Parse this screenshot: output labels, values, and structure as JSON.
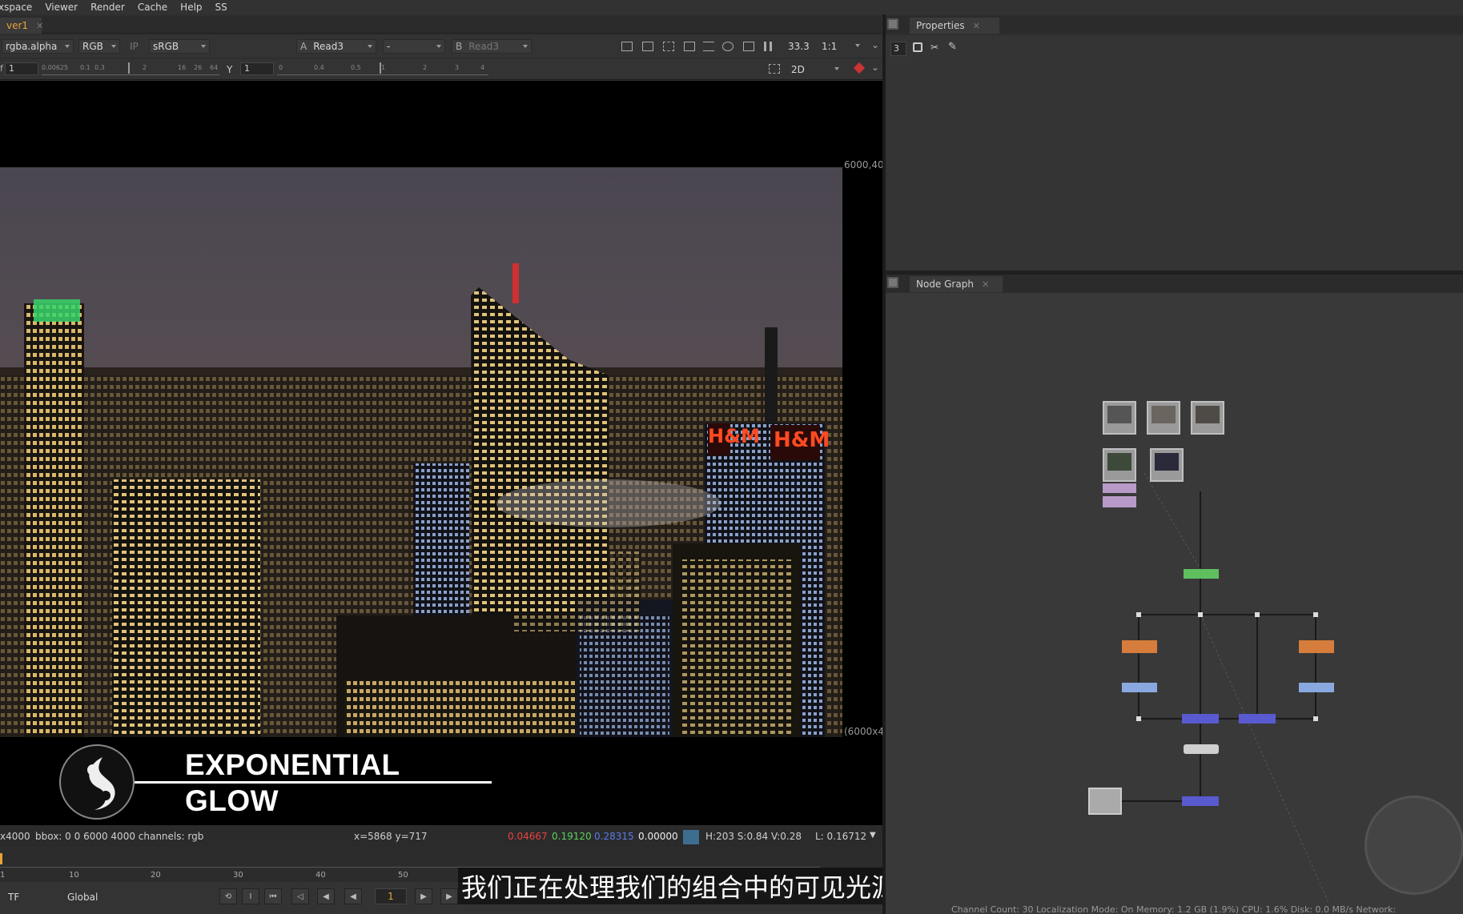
{
  "menu": [
    "xspace",
    "Viewer",
    "Render",
    "Cache",
    "Help",
    "SS"
  ],
  "viewer": {
    "tab_label": "ver1",
    "channels": "rgba.alpha",
    "colorspace_rgb": "RGB",
    "ip": "IP",
    "lut": "sRGB",
    "input_a_label": "A",
    "input_a": "Read3",
    "blend": "-",
    "input_b_label": "B",
    "input_b": "Read3",
    "zoom": "33.3",
    "proxy": "1:1",
    "gain_value": "1",
    "gamma_label": "Y",
    "gamma_value": "1",
    "view_mode": "2D",
    "gain_ticks": [
      "0.00625",
      "0.1",
      "0.3",
      "2",
      "16",
      "26",
      "64"
    ],
    "gamma_ticks": [
      "0",
      "0.4",
      "0.5",
      "1",
      "2",
      "3",
      "4"
    ],
    "format_top": "6000,40",
    "format_bottom": "(6000x4"
  },
  "logo": {
    "line1": "EXPONENTIAL",
    "line2": "GLOW"
  },
  "info_bar": {
    "format": "x4000",
    "bbox": "bbox: 0 0 6000 4000 channels: rgb",
    "cursor": "x=5868 y=717",
    "r": "0.04667",
    "g": "0.19120",
    "b": "0.28315",
    "a": "0.00000",
    "hsv": "H:203 S:0.84 V:0.28",
    "luminance": "L: 0.16712",
    "colors": {
      "r": "#e84040",
      "g": "#5cd05c",
      "b": "#5a7ae8",
      "swatch": "#3d6e90"
    }
  },
  "timeline": {
    "ticks": [
      "1",
      "10",
      "20",
      "30",
      "40",
      "50"
    ],
    "current_frame": "1",
    "tf": "TF",
    "scope": "Global"
  },
  "subtitle": "我们正在处理我们的组合中的可见光源，",
  "properties": {
    "tab_label": "Properties",
    "max_panels": "3"
  },
  "node_graph": {
    "tab_label": "Node Graph",
    "status": "Channel Count: 30  Localization Mode: On  Memory: 1.2 GB (1.9%)  CPU: 1.6%  Disk: 0.0 MB/s  Network:"
  },
  "accent": "#e8a33a"
}
